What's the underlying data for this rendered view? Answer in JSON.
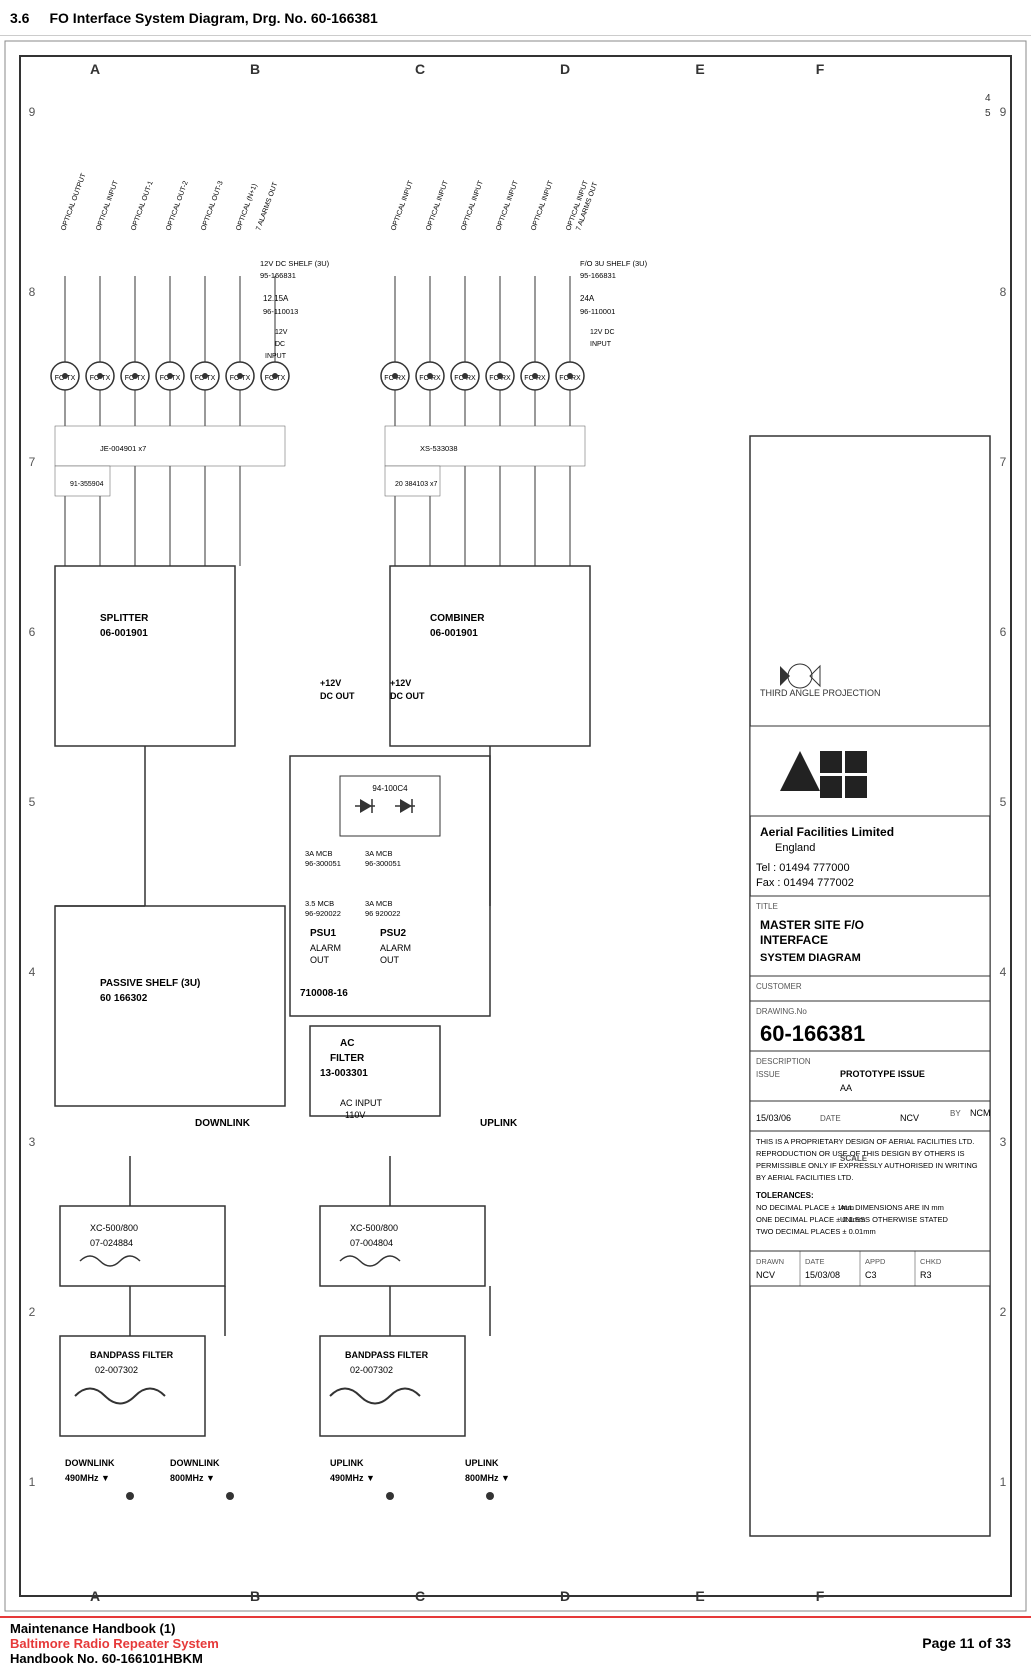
{
  "header": {
    "section": "3.6",
    "title": "FO Interface System Diagram, Drg. No. 60-166381"
  },
  "footer": {
    "line1": "Maintenance Handbook (1)",
    "line2": "Baltimore Radio Repeater System",
    "line3": "Handbook No. 60-166101HBKM",
    "page": "Page 11 of 33"
  },
  "drawing": {
    "title_block": {
      "company": "Aerial Facilities Limited",
      "country": "England",
      "tel": "Tel : 01494 777000",
      "fax": "Fax : 01494 777002",
      "drawing_title": "MASTER SITE F/O INTERFACE SYSTEM DIAGRAM",
      "drawing_no": "60-166381",
      "issue": "PROTOTYPE ISSUE",
      "date": "15/03/06",
      "drawn_by": "NCV",
      "appd": "C3",
      "chkd": "R3",
      "scale": "",
      "projection": "THIRD ANGLE PROJECTION"
    }
  }
}
